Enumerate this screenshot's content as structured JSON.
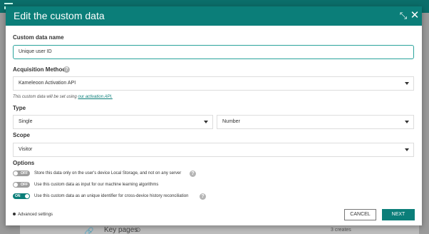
{
  "background": {
    "row_label": "Key pages",
    "row_meta": "3 creates"
  },
  "modal": {
    "title": "Edit the custom data",
    "name_label": "Custom data name",
    "name_value": "Unique user ID",
    "acq_label": "Acquisition Method",
    "acq_value": "Kameleoon Activation API",
    "note_prefix": "This custom data will be set using ",
    "note_link": "our activation API.",
    "type_label": "Type",
    "type_value": "Single",
    "format_value": "Number",
    "scope_label": "Scope",
    "scope_value": "Visitor",
    "options_label": "Options",
    "options": [
      {
        "state": "OFF",
        "text": "Store this data only on the user's device Local Storage, and not on any server"
      },
      {
        "state": "OFF",
        "text": "Use this custom data as input for our machine learning algorithms"
      },
      {
        "state": "ON",
        "text": "Use this custom data as an unique identifier for cross-device history reconciliation"
      }
    ],
    "advanced": "Advanced settings",
    "cancel": "CANCEL",
    "next": "NEXT"
  },
  "colors": {
    "accent": "#0b7e79",
    "toggle_off": "#9e9e9e"
  }
}
